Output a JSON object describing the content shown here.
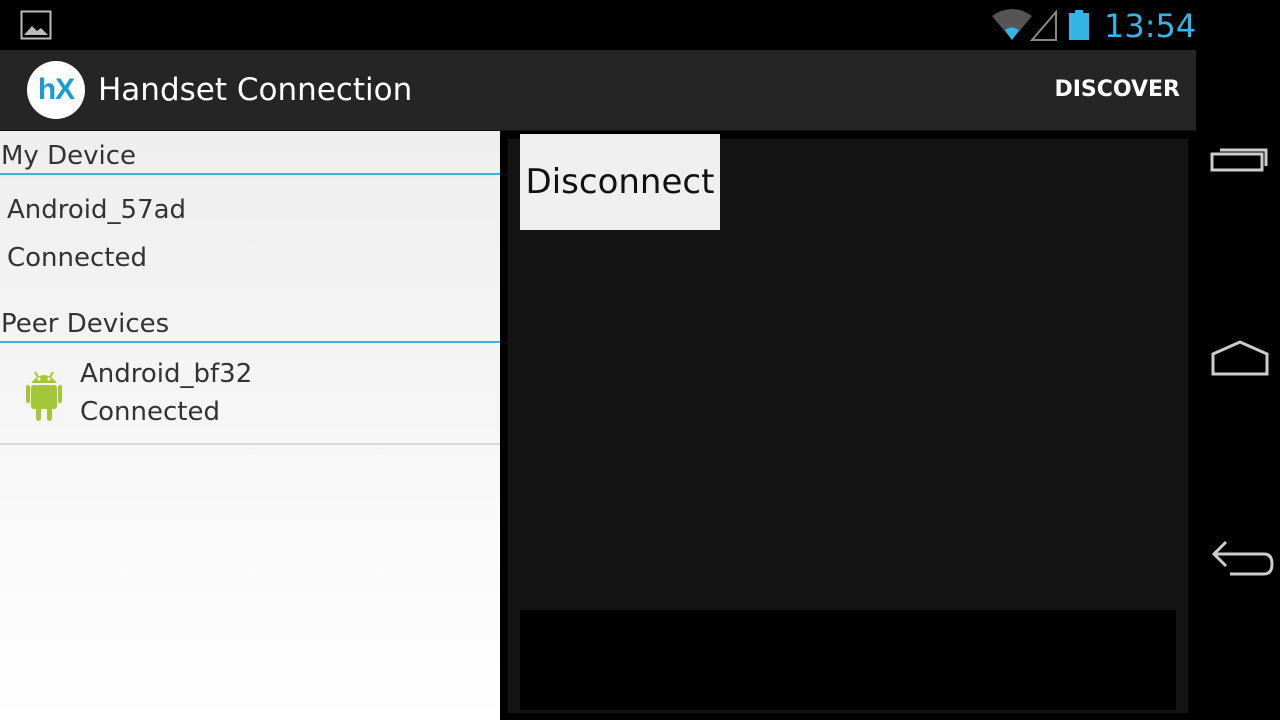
{
  "status_bar": {
    "time": "13:54",
    "icons": [
      "gallery-icon",
      "wifi-icon",
      "signal-icon",
      "battery-icon"
    ],
    "accent_color": "#33b5e5"
  },
  "action_bar": {
    "logo_text": "hX",
    "title": "Handset Connection",
    "discover_label": "DISCOVER"
  },
  "left_pane": {
    "my_device_header": "My Device",
    "my_device_name": "Android_57ad",
    "my_device_status": "Connected",
    "peer_devices_header": "Peer Devices",
    "peers": [
      {
        "name": "Android_bf32",
        "status": "Connected",
        "icon": "android-icon"
      }
    ]
  },
  "right_pane": {
    "disconnect_label": "Disconnect"
  },
  "nav_bar": {
    "icons": [
      "recent-apps-icon",
      "home-icon",
      "back-icon"
    ]
  }
}
